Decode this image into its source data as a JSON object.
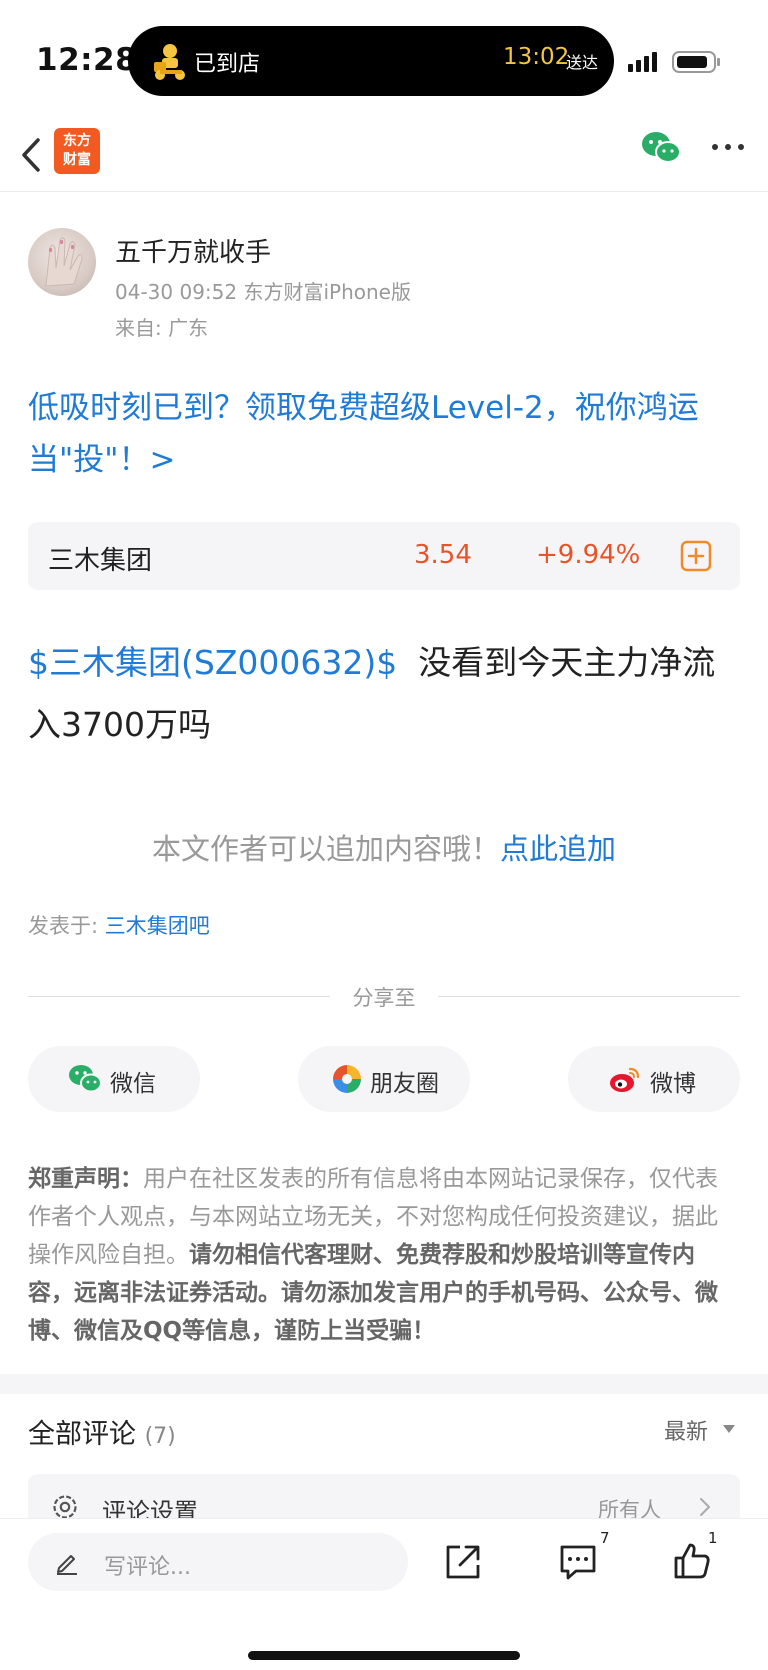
{
  "status_bar": {
    "time": "12:28",
    "live_activity": {
      "text": "已到店",
      "eta": "13:02",
      "eta_suffix": "送达"
    }
  },
  "nav": {
    "logo_text": "东方\n财富",
    "icons": [
      "back-icon",
      "wechat-icon",
      "more-icon"
    ]
  },
  "author": {
    "name": "五千万就收手",
    "meta": "04-30 09:52 东方财富iPhone版",
    "from": "来自: 广东"
  },
  "promo": {
    "text": "低吸时刻已到？领取免费超级Level-2，祝你鸿运当\"投\"！>"
  },
  "stock": {
    "name": "三木集团",
    "price": "3.54",
    "change": "+9.94%"
  },
  "post": {
    "stock_tag": "$三木集团(SZ000632)$",
    "text": "  没看到今天主力净流入3700万吗"
  },
  "append": {
    "prompt": "本文作者可以追加内容哦！",
    "link": "点此追加"
  },
  "posted_in": {
    "label": "发表于: ",
    "bar": "三木集团吧"
  },
  "share": {
    "label": "分享至",
    "buttons": [
      {
        "label": "微信",
        "icon": "wechat-icon"
      },
      {
        "label": "朋友圈",
        "icon": "moments-icon"
      },
      {
        "label": "微博",
        "icon": "weibo-icon"
      }
    ]
  },
  "disclaimer": {
    "title": "郑重声明：",
    "body": "用户在社区发表的所有信息将由本网站记录保存，仅代表作者个人观点，与本网站立场无关，不对您构成任何投资建议，据此操作风险自担。",
    "warning": "请勿相信代客理财、免费荐股和炒股培训等宣传内容，远离非法证券活动。请勿添加发言用户的手机号码、公众号、微博、微信及QQ等信息，谨防上当受骗！"
  },
  "comments": {
    "title": "全部评论",
    "count": "(7)",
    "sort": "最新",
    "settings_label": "评论设置",
    "settings_value": "所有人"
  },
  "bottom_bar": {
    "placeholder": "写评论...",
    "comment_count": "7",
    "like_count": "1"
  },
  "colors": {
    "link_blue": "#1f7bd6",
    "rise_red": "#e8542a",
    "brand_orange": "#f25a22",
    "wechat_green": "#2aae67"
  }
}
